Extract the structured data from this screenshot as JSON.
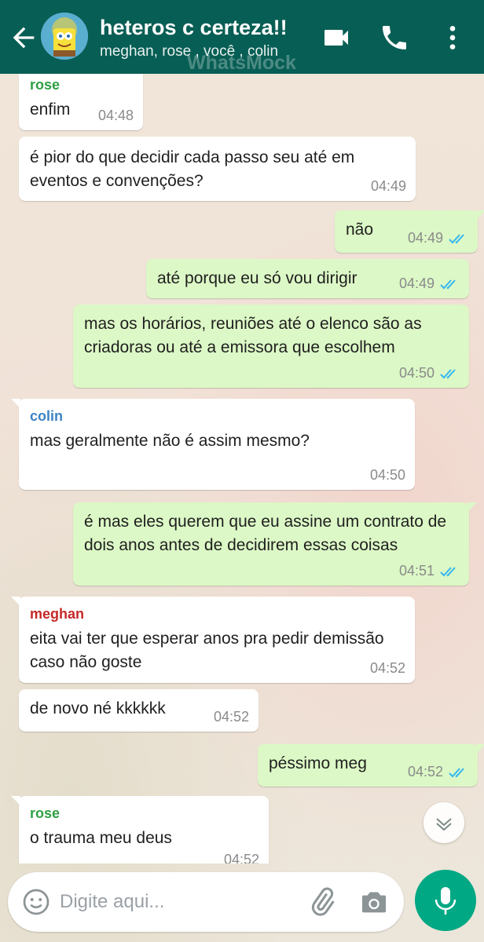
{
  "header": {
    "title": "heteros c certeza!!",
    "participants": "meghan, rose , você , colin",
    "watermark": "WhatsMock"
  },
  "messages": [
    {
      "direction": "in",
      "sender": "rose",
      "sender_color": "#2ea043",
      "text": "enfim",
      "time": "04:48"
    },
    {
      "direction": "in",
      "text": "é pior do que decidir cada passo seu até em eventos e convenções?",
      "time": "04:49"
    },
    {
      "direction": "out",
      "text": "não",
      "time": "04:49",
      "read": true
    },
    {
      "direction": "out",
      "text": "até porque eu só vou dirigir",
      "time": "04:49",
      "read": true
    },
    {
      "direction": "out",
      "text": "mas os horários, reuniões até o elenco são as criadoras ou até a emissora que escolhem",
      "time": "04:50",
      "read": true
    },
    {
      "direction": "in",
      "sender": "colin",
      "sender_color": "#3b83c4",
      "text": "mas geralmente não é assim mesmo?",
      "time": "04:50"
    },
    {
      "direction": "out",
      "text": "é mas eles querem que eu assine um contrato de dois anos antes de decidirem essas coisas",
      "time": "04:51",
      "read": true
    },
    {
      "direction": "in",
      "sender": "meghan",
      "sender_color": "#c62828",
      "text": "eita vai ter que esperar anos pra pedir demissão caso não goste",
      "time": "04:52"
    },
    {
      "direction": "in",
      "text": "de novo né kkkkkk",
      "time": "04:52"
    },
    {
      "direction": "out",
      "text": "péssimo meg",
      "time": "04:52",
      "read": true
    },
    {
      "direction": "in",
      "sender": "rose",
      "sender_color": "#2ea043",
      "text": "o trauma meu deus",
      "time": "04:52"
    }
  ],
  "composer": {
    "placeholder": "Digite aqui..."
  },
  "colors": {
    "header_bg": "#075e54",
    "outgoing_bubble": "#dcf8c6",
    "incoming_bubble": "#ffffff",
    "read_ticks": "#34b7f1",
    "mic_button": "#00a884"
  },
  "icons": [
    "back-arrow-icon",
    "group-avatar",
    "video-call-icon",
    "phone-icon",
    "more-options-icon",
    "scroll-down-icon",
    "emoji-icon",
    "attach-icon",
    "camera-icon",
    "mic-icon"
  ]
}
